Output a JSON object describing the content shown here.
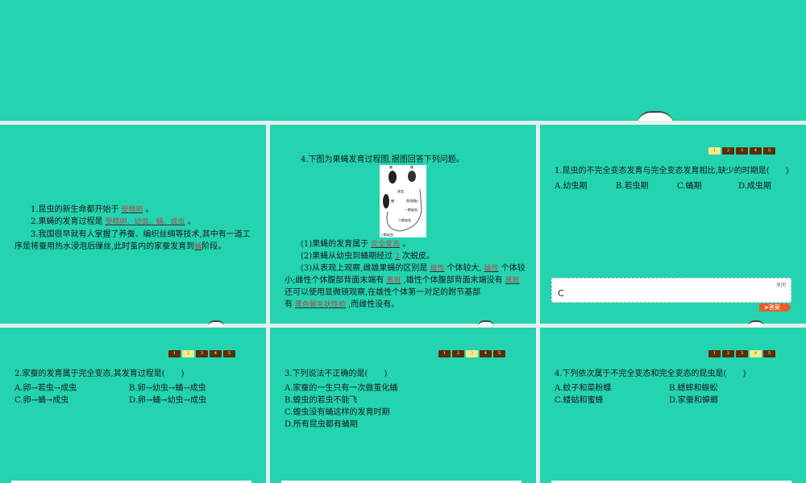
{
  "pager": [
    "1",
    "2",
    "3",
    "4",
    "5"
  ],
  "slide1": {
    "q1_pre": "1.昆虫的新生命都开始于",
    "q1_ans": "受精卵",
    "q1_post": "。",
    "q2_pre": "2.果蝇的发育过程是",
    "q2_ans": "受精卵、幼虫、蛹、成虫",
    "q2_post": "。",
    "q3_line1": "3.我国很早就有人掌握了养蚕、编织丝绸等技术,其中有一道工",
    "q3_line2_pre": "序是将蚕用热水浸泡后缫丝,此时茧内的家蚕发育到",
    "q3_ans": "蛹",
    "q3_post": "阶段。"
  },
  "slide2": {
    "title": "4.下图为果蝇发育过程图,据图回答下列问题。",
    "diagram_labels": {
      "male": "雄",
      "female": "雌",
      "adult": "成虫",
      "pupa": "蛹",
      "egg": "卵(胚胎)",
      "l1": "一龄幼虫",
      "l2": "二龄幼虫",
      "l3": "三龄幼虫"
    },
    "p1_pre": "(1)果蝇的发育属于",
    "p1_ans": "完全变态",
    "p1_post": "。",
    "p2_pre": "(2)果蝇从幼虫到蛹期经过",
    "p2_ans": "2",
    "p2_post": "次蜕皮。",
    "p3_a": "(3)从表观上观察,雌雄果蝇的区别是",
    "p3_ans1": "雌性",
    "p3_b": "个体较大,",
    "p3_ans2": "雄性",
    "p3_c": "个体较",
    "p3_d": "小;雌性个体腹部背面末端有",
    "p3_ans3": "黑斑",
    "p3_e": ",雄性个体腹部背面末端没有",
    "p3_ans4": "黑斑",
    "p3_f": "还可以使用显微镜观察,在雄性个体第一对足的跗节基部",
    "p3_g": "有",
    "p3_ans5": "黑色鬃毛状性梳",
    "p3_h": ",而雌性没有。"
  },
  "slide3": {
    "question": "1.昆虫的不完全变态发育与完全变态发育相比,缺少的时期是(　　)",
    "options": [
      "A.幼虫期",
      "B.若虫期",
      "C.蛹期",
      "D.成虫期"
    ],
    "close": "关闭",
    "answer": "C",
    "answer_btn": "➤答案",
    "active": 1
  },
  "slide4": {
    "question": "2.家蚕的发育属于完全变态,其发育过程是(　　)",
    "options": [
      "A.卵→若虫→成虫",
      "B.卵→幼虫→蛹→成虫",
      "C.卵→蛹→成虫",
      "D.卵→蛹→幼虫→成虫"
    ],
    "active": 2
  },
  "slide5": {
    "question": "3.下列说法不正确的是(　　)",
    "options": [
      "A.家蚕的一生只有一次做茧化蛹",
      "B.蝗虫的若虫不能飞",
      "C.蝗虫没有蛹这样的发育时期",
      "D.所有昆虫都有蛹期"
    ],
    "active": 3
  },
  "slide6": {
    "question": "4.下列依次属于不完全变态和完全变态的昆虫是(　　)",
    "options": [
      "A.蚊子和菜粉蝶",
      "B.蟋蟀和蜈蚣",
      "C.蝼蛄和蜜蜂",
      "D.家蚕和蟑螂"
    ],
    "active": 4
  },
  "colors": {
    "slide_bg": "#24d3b0",
    "pager": "#5a2e08",
    "pager_active": "#f3ea8c",
    "answer_btn": "#e2622a",
    "answer_text": "#b4474a"
  }
}
